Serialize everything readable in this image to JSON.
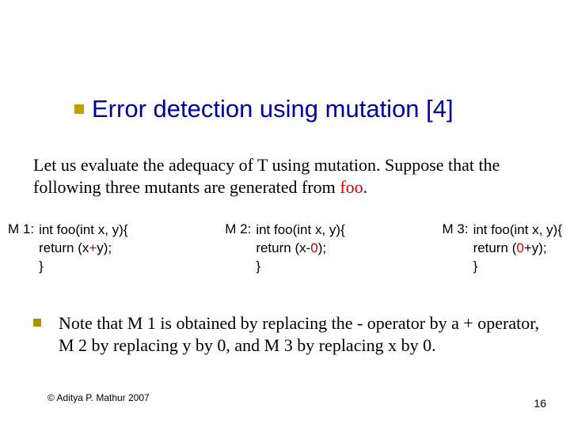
{
  "title": "Error detection using mutation [4]",
  "intro": {
    "pre": "Let us evaluate the adequacy of T using mutation. Suppose that the following three mutants are generated from ",
    "foo": "foo",
    "post": "."
  },
  "mutants": {
    "m1": {
      "label": "M 1:",
      "sig": "int foo(int x, y){",
      "ret_pre": "return (x",
      "op": "+",
      "ret_post": "y);",
      "close": "}"
    },
    "m2": {
      "label": "M 2:",
      "sig": "int foo(int x, y){",
      "ret_pre": "return (x-",
      "op": "0",
      "ret_post": ");",
      "close": "}"
    },
    "m3": {
      "label": "M 3:",
      "sig": "int foo(int x, y){",
      "ret_pre": "return (",
      "op": "0",
      "ret_post": "+y);",
      "close": "}"
    }
  },
  "note": "Note that M 1 is obtained by replacing the - operator by a + operator, M 2 by replacing y by 0, and M 3 by replacing x by 0.",
  "footer": {
    "copyright": "© Aditya P. Mathur 2007",
    "page": "16"
  },
  "colors": {
    "title": "#000099",
    "accent": "#cc0000",
    "bullet": "#c0a000"
  }
}
